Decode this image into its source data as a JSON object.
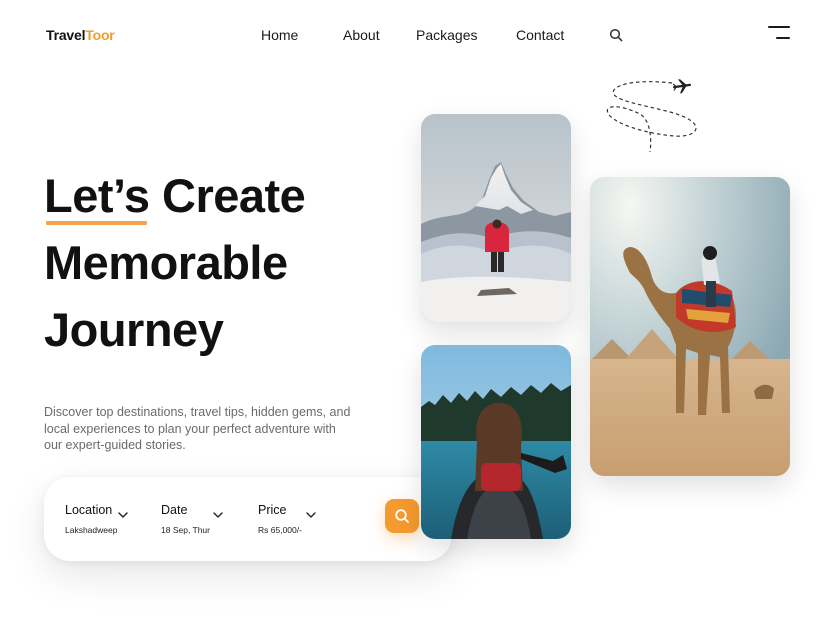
{
  "brand": {
    "name_part1": "Travel",
    "name_part2": "Toor",
    "accent_color": "#f59a2f"
  },
  "nav": {
    "items": [
      {
        "label": "Home"
      },
      {
        "label": "About"
      },
      {
        "label": "Packages"
      },
      {
        "label": "Contact"
      }
    ],
    "search_icon": "search-icon",
    "menu_icon": "menu-icon"
  },
  "hero": {
    "headline_word1": "Let’s",
    "headline_rest1": " Create",
    "headline_line2": "Memorable",
    "headline_line3": "Journey",
    "underline_color": "#f5a350",
    "description": "Discover top destinations, travel tips, hidden gems, and local experiences to plan your perfect adventure with our expert-guided stories."
  },
  "search": {
    "fields": [
      {
        "label": "Location",
        "value": "Lakshadweep",
        "icon": "chevron-down-icon"
      },
      {
        "label": "Date",
        "value": "18 Sep, Thur",
        "icon": "chevron-down-icon"
      },
      {
        "label": "Price",
        "value": "Rs 65,000/-",
        "icon": "chevron-down-icon"
      }
    ],
    "button_icon": "search-icon"
  },
  "gallery": {
    "images": [
      {
        "name": "mountain-hiker-photo"
      },
      {
        "name": "lake-canoe-photo"
      },
      {
        "name": "camel-pyramids-photo"
      }
    ],
    "decoration": "airplane-path-icon"
  }
}
